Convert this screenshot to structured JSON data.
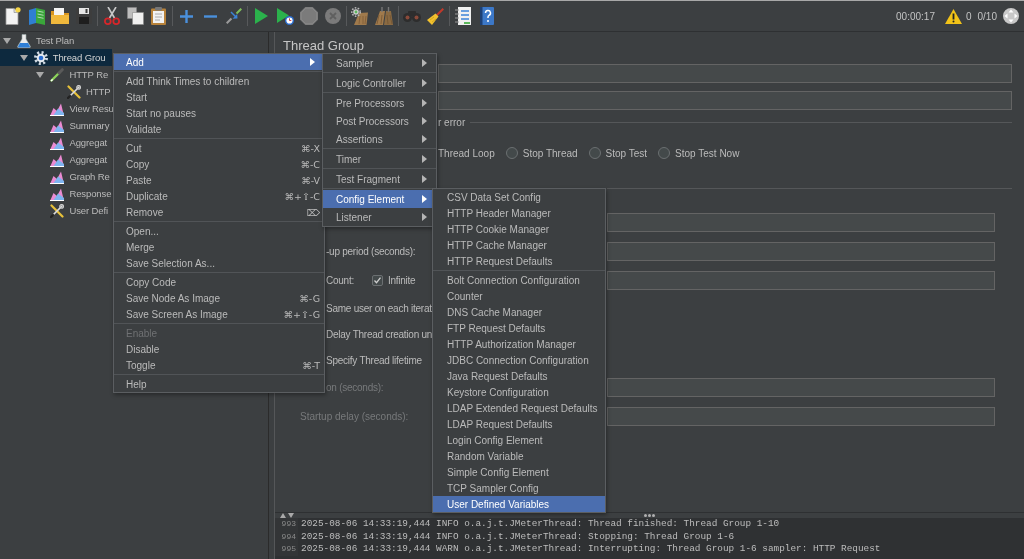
{
  "toolbar": {
    "elapsed": "00:00:17",
    "error_count": "0",
    "threads": "0/10"
  },
  "tree": [
    {
      "label": "Test Plan",
      "kind": "plan",
      "expanded": true,
      "selected": false,
      "children": [
        {
          "label": "Thread Grou",
          "kind": "thread-group",
          "expanded": true,
          "selected": true,
          "children": [
            {
              "label": "HTTP Re",
              "kind": "sampler",
              "expanded": true,
              "selected": false,
              "children": [
                {
                  "label": "HTTP",
                  "kind": "config",
                  "selected": false
                }
              ]
            },
            {
              "label": "View Resu",
              "kind": "listener",
              "selected": false
            },
            {
              "label": "Summary",
              "kind": "listener",
              "selected": false
            },
            {
              "label": "Aggregat",
              "kind": "listener",
              "selected": false
            },
            {
              "label": "Aggregat",
              "kind": "listener",
              "selected": false
            },
            {
              "label": "Graph Re",
              "kind": "listener",
              "selected": false
            },
            {
              "label": "Response",
              "kind": "listener",
              "selected": false
            },
            {
              "label": "User Defi",
              "kind": "config",
              "selected": false
            }
          ]
        }
      ]
    }
  ],
  "panel": {
    "title": "Thread Group",
    "error_action": {
      "title": "r error",
      "covered_option": "Thread Loop",
      "options": [
        {
          "label": "Stop Thread",
          "selected": false
        },
        {
          "label": "Stop Test",
          "selected": false
        },
        {
          "label": "Stop Test Now",
          "selected": false
        }
      ]
    },
    "thread_properties": [
      {
        "kind": "field"
      },
      {
        "kind": "field",
        "label": "-up period (seconds):",
        "disabled": false
      },
      {
        "kind": "loop",
        "label": "Count:",
        "checkbox_label": "Infinite",
        "checked": true
      },
      {
        "kind": "text",
        "label": "Same user on each iterat"
      },
      {
        "kind": "text",
        "label": "Delay Thread creation un"
      },
      {
        "kind": "text",
        "label": "Specify Thread lifetime"
      },
      {
        "kind": "field",
        "label": "on (seconds):",
        "disabled": true
      },
      {
        "kind": "field",
        "label": "Startup delay (seconds):",
        "disabled": true
      }
    ]
  },
  "context_menu": {
    "groups": [
      [
        {
          "label": "Add",
          "selected": true,
          "disabled": false,
          "submenu": true
        }
      ],
      [
        {
          "label": "Add Think Times to children",
          "selected": false,
          "disabled": false,
          "submenu": false
        },
        {
          "label": "Start",
          "selected": false,
          "disabled": false,
          "submenu": false
        },
        {
          "label": "Start no pauses",
          "selected": false,
          "disabled": false,
          "submenu": false
        },
        {
          "label": "Validate",
          "selected": false,
          "disabled": false,
          "submenu": false
        }
      ],
      [
        {
          "label": "Cut",
          "shortcut": "⌘-X",
          "selected": false,
          "disabled": false,
          "submenu": false
        },
        {
          "label": "Copy",
          "shortcut": "⌘-C",
          "selected": false,
          "disabled": false,
          "submenu": false
        },
        {
          "label": "Paste",
          "shortcut": "⌘-V",
          "selected": false,
          "disabled": false,
          "submenu": false
        },
        {
          "label": "Duplicate",
          "shortcut": "⌘+⇧-C",
          "selected": false,
          "disabled": false,
          "submenu": false
        },
        {
          "label": "Remove",
          "shortcut": "⌦",
          "selected": false,
          "disabled": false,
          "submenu": false
        }
      ],
      [
        {
          "label": "Open...",
          "selected": false,
          "disabled": false,
          "submenu": false
        },
        {
          "label": "Merge",
          "selected": false,
          "disabled": false,
          "submenu": false
        },
        {
          "label": "Save Selection As...",
          "selected": false,
          "disabled": false,
          "submenu": false
        }
      ],
      [
        {
          "label": "Copy Code",
          "selected": false,
          "disabled": false,
          "submenu": false
        },
        {
          "label": "Save Node As Image",
          "shortcut": "⌘-G",
          "selected": false,
          "disabled": false,
          "submenu": false
        },
        {
          "label": "Save Screen As Image",
          "shortcut": "⌘+⇧-G",
          "selected": false,
          "disabled": false,
          "submenu": false
        }
      ],
      [
        {
          "label": "Enable",
          "selected": false,
          "disabled": true,
          "submenu": false
        },
        {
          "label": "Disable",
          "selected": false,
          "disabled": false,
          "submenu": false
        },
        {
          "label": "Toggle",
          "shortcut": "⌘-T",
          "selected": false,
          "disabled": false,
          "submenu": false
        }
      ],
      [
        {
          "label": "Help",
          "selected": false,
          "disabled": false,
          "submenu": false
        }
      ]
    ]
  },
  "add_submenu": {
    "groups": [
      [
        {
          "label": "Sampler",
          "selected": false,
          "submenu": true
        }
      ],
      [
        {
          "label": "Logic Controller",
          "selected": false,
          "submenu": true
        }
      ],
      [
        {
          "label": "Pre Processors",
          "selected": false,
          "submenu": true
        },
        {
          "label": "Post Processors",
          "selected": false,
          "submenu": true
        },
        {
          "label": "Assertions",
          "selected": false,
          "submenu": true
        }
      ],
      [
        {
          "label": "Timer",
          "selected": false,
          "submenu": true
        }
      ],
      [
        {
          "label": "Test Fragment",
          "selected": false,
          "submenu": true
        }
      ],
      [
        {
          "label": "Config Element",
          "selected": true,
          "submenu": true
        },
        {
          "label": "Listener",
          "selected": false,
          "submenu": true
        }
      ]
    ]
  },
  "config_submenu": {
    "groups": [
      [
        {
          "label": "CSV Data Set Config",
          "selected": false
        },
        {
          "label": "HTTP Header Manager",
          "selected": false
        },
        {
          "label": "HTTP Cookie Manager",
          "selected": false
        },
        {
          "label": "HTTP Cache Manager",
          "selected": false
        },
        {
          "label": "HTTP Request Defaults",
          "selected": false
        }
      ],
      [
        {
          "label": "Bolt Connection Configuration",
          "selected": false
        },
        {
          "label": "Counter",
          "selected": false
        },
        {
          "label": "DNS Cache Manager",
          "selected": false
        },
        {
          "label": "FTP Request Defaults",
          "selected": false
        },
        {
          "label": "HTTP Authorization Manager",
          "selected": false
        },
        {
          "label": "JDBC Connection Configuration",
          "selected": false
        },
        {
          "label": "Java Request Defaults",
          "selected": false
        },
        {
          "label": "Keystore Configuration",
          "selected": false
        },
        {
          "label": "LDAP Extended Request Defaults",
          "selected": false
        },
        {
          "label": "LDAP Request Defaults",
          "selected": false
        },
        {
          "label": "Login Config Element",
          "selected": false
        },
        {
          "label": "Random Variable",
          "selected": false
        },
        {
          "label": "Simple Config Element",
          "selected": false
        },
        {
          "label": "TCP Sampler Config",
          "selected": false
        },
        {
          "label": "User Defined Variables",
          "selected": true
        }
      ]
    ]
  },
  "log": {
    "lines": [
      {
        "number": "993",
        "text": "2025-08-06 14:33:19,444 INFO o.a.j.t.JMeterThread: Thread finished: Thread Group 1-10"
      },
      {
        "number": "994",
        "text": "2025-08-06 14:33:19,444 INFO o.a.j.t.JMeterThread: Stopping: Thread Group 1-6"
      },
      {
        "number": "995",
        "text": "2025-08-06 14:33:19,444 WARN o.a.j.t.JMeterThread: Interrupting: Thread Group 1-6 sampler: HTTP Request"
      }
    ]
  }
}
